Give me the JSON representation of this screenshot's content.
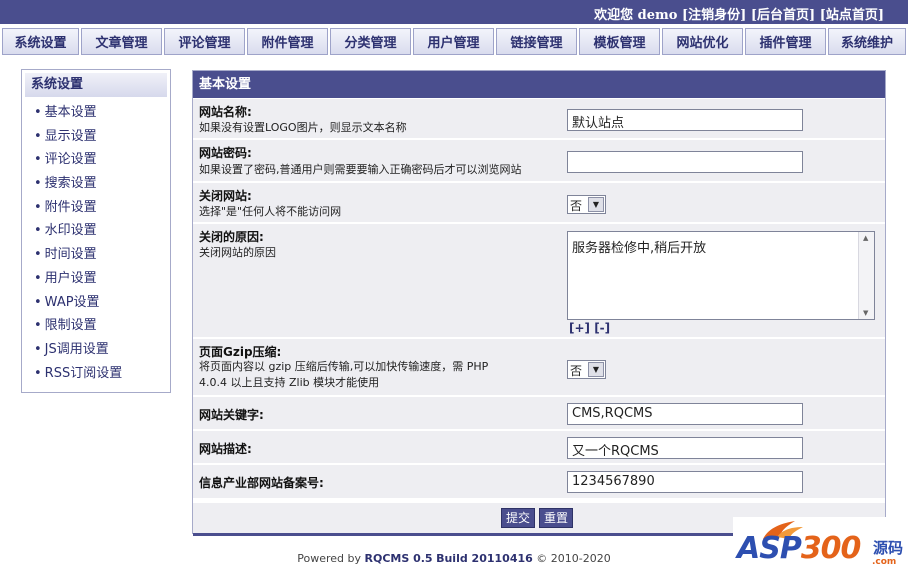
{
  "header": {
    "welcome": "欢迎您 demo",
    "logout": "[注销身份]",
    "admin_home": "[后台首页]",
    "site_home": "[站点首页]"
  },
  "nav": [
    "系统设置",
    "文章管理",
    "评论管理",
    "附件管理",
    "分类管理",
    "用户管理",
    "链接管理",
    "模板管理",
    "网站优化",
    "插件管理",
    "系统维护"
  ],
  "sidebar": {
    "title": "系统设置",
    "items": [
      "基本设置",
      "显示设置",
      "评论设置",
      "搜索设置",
      "附件设置",
      "水印设置",
      "时间设置",
      "用户设置",
      "WAP设置",
      "限制设置",
      "JS调用设置",
      "RSS订阅设置"
    ]
  },
  "panel": {
    "title": "基本设置",
    "site_name": {
      "label": "网站名称:",
      "desc": "如果没有设置LOGO图片，则显示文本名称",
      "value": "默认站点"
    },
    "site_password": {
      "label": "网站密码:",
      "desc": "如果设置了密码,普通用户则需要要输入正确密码后才可以浏览网站",
      "value": ""
    },
    "close_site": {
      "label": "关闭网站:",
      "desc": "选择\"是\"任何人将不能访问网",
      "value": "否"
    },
    "close_reason": {
      "label": "关闭的原因:",
      "desc": "关闭网站的原因",
      "value": "服务器检修中,稍后开放",
      "resize": "[+] [-]"
    },
    "gzip": {
      "label": "页面Gzip压缩:",
      "desc_line1": "将页面内容以 gzip 压缩后传输,可以加快传输速度，需 PHP",
      "desc_line2": "4.0.4 以上且支持 Zlib 模块才能使用",
      "value": "否"
    },
    "keywords": {
      "label": "网站关键字:",
      "value": "CMS,RQCMS"
    },
    "description": {
      "label": "网站描述:",
      "value": "又一个RQCMS"
    },
    "icp": {
      "label": "信息产业部网站备案号:",
      "value": "1234567890"
    },
    "submit": "提交",
    "reset": "重置"
  },
  "footer": {
    "prefix": "Powered by",
    "product": "RQCMS 0.5",
    "build": "Build 20110416",
    "copyright": "© 2010-2020"
  },
  "watermark": {
    "brand_a": "ASP",
    "brand_b": "300",
    "suffix": "源码",
    "domain": ".com"
  },
  "colors": {
    "primary": "#4a4e8e",
    "row_bg": "#eeeef2",
    "nav_text": "#2d3170"
  }
}
